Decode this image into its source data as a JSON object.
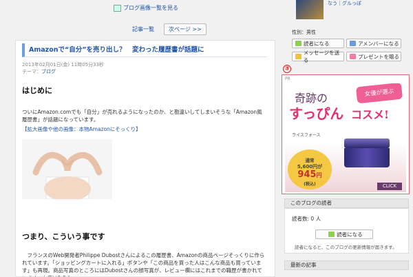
{
  "header": {
    "gallery_link": "ブログ画像一覧を見る",
    "nav_list": "記事一覧",
    "nav_next": "次ページ >>"
  },
  "article": {
    "title": "Amazonで“自分”を売り出し？　変わった履歴書が話題に",
    "date": "2013年02月01日(金) 11時05分33秒",
    "theme_label": "テーマ：",
    "theme_value": "ブログ",
    "heading1": "はじめに",
    "p1": "ついにAmazon.comでも「自分」が売れるようになったのか、と勘違いしてしまいそうな「Amazon風履歴書」が話題になっています。",
    "image_link": "【拡大画像や他の画像：本物Amazonにそっくり】",
    "heading2": "つまり、こういう事です",
    "p2": "　フランスのWeb開発者Philippe Dubostさんによるこの履歴書、Amazonの商品ページそっくりに作られています。「ショッピングカートに入れる」ボタンや「この商品を買った人はこんな商品も買っています」も再現。商品写真のところにはDubostさんの顔写真が、レビュー欄にはこれまでの職歴が書かれています。在庫は1点の"
  },
  "sidebar": {
    "profile_links": "なう｜グルっぽ",
    "gender": "性別：男性",
    "btn_reader": "読者になる",
    "btn_amember": "アメンバーになる",
    "btn_message": "メッセージを送る",
    "btn_present": "プレゼントを贈る",
    "marker": "③",
    "pr_label": "PR",
    "ad": {
      "line1": "奇跡の",
      "line2": "すっぴん",
      "line3": "コスメ!",
      "bubble": "女優が選ぶ",
      "brand": "ライスフォース",
      "price_label": "通常",
      "price_old": "5,600円が",
      "price_new": "945",
      "yen": "円",
      "tax": "(税込)",
      "click": "CLICK"
    },
    "readers_header": "このブログの読者",
    "readers_count": "読者数: 0 人",
    "readers_button": "読者になる",
    "readers_note": "読者になると、このブログの更新情報が届きます。",
    "recent_header": "最新の記事"
  }
}
